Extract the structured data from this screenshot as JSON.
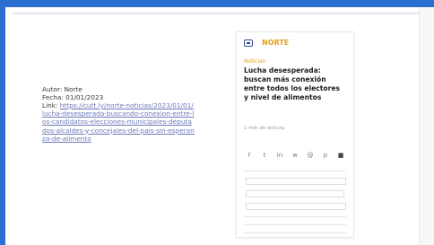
{
  "metadata": {
    "author_line": "Autor: Norte",
    "date_line": "Fecha: 01/01/2023",
    "link_label": "Link:",
    "link_url": "https://cutt.ly/norte-noticias/2023/01/01/lucha-desesperada-buscando-conexion-entre-los-candidatos-elecciones-municipales-deputados-alcaldes-y-concejales-del-pais-sin-esperanza-de-alimento"
  },
  "card": {
    "brand": "NORTE",
    "section": "Noticias",
    "headline": "Lucha desesperada: buscan más conexión entre todos los electores y nivel de alimentos",
    "byline": "1 min de lectura",
    "share_icons": [
      "facebook-icon",
      "twitter-icon",
      "linkedin-icon",
      "whatsapp-icon",
      "email-icon",
      "print-icon",
      "bookmark-icon"
    ],
    "share_glyphs": [
      "f",
      "t",
      "in",
      "w",
      "@",
      "p",
      "■"
    ]
  }
}
